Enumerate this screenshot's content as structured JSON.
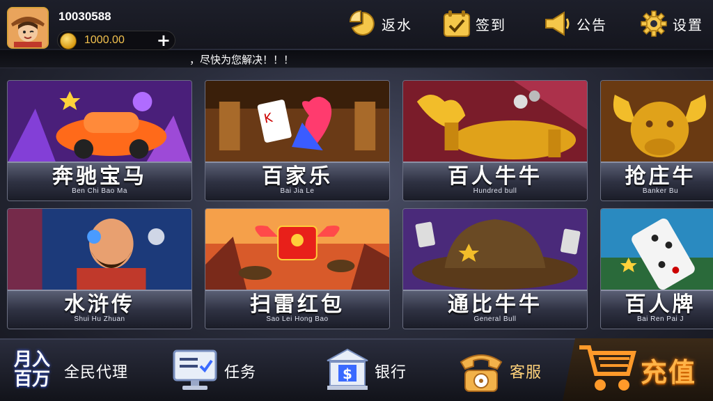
{
  "user": {
    "id": "10030588",
    "balance": "1000.00"
  },
  "top_buttons": [
    {
      "key": "rebate",
      "label": "返水",
      "icon": "pie-chart-icon"
    },
    {
      "key": "checkin",
      "label": "签到",
      "icon": "calendar-check-icon"
    },
    {
      "key": "notice",
      "label": "公告",
      "icon": "megaphone-icon"
    },
    {
      "key": "settings",
      "label": "设置",
      "icon": "gear-icon"
    }
  ],
  "marquee": "，尽快为您解决！！！",
  "games": [
    {
      "zh": "奔驰宝马",
      "en": "Ben Chi Bao Ma"
    },
    {
      "zh": "百家乐",
      "en": "Bai Jia Le"
    },
    {
      "zh": "百人牛牛",
      "en": "Hundred bull"
    },
    {
      "zh": "抢庄牛",
      "en": "Banker Bu"
    },
    {
      "zh": "水浒传",
      "en": "Shui Hu Zhuan"
    },
    {
      "zh": "扫雷红包",
      "en": "Sao Lei Hong Bao"
    },
    {
      "zh": "通比牛牛",
      "en": "General Bull"
    },
    {
      "zh": "百人牌",
      "en": "Bai Ren Pai J"
    }
  ],
  "bottom_buttons": {
    "agent": "全民代理",
    "agent_badge": "月入百万",
    "tasks": "任务",
    "bank": "银行",
    "service": "客服",
    "recharge": "充值"
  },
  "colors": {
    "gold": "#f2c14e",
    "accent_orange": "#ffb347"
  }
}
